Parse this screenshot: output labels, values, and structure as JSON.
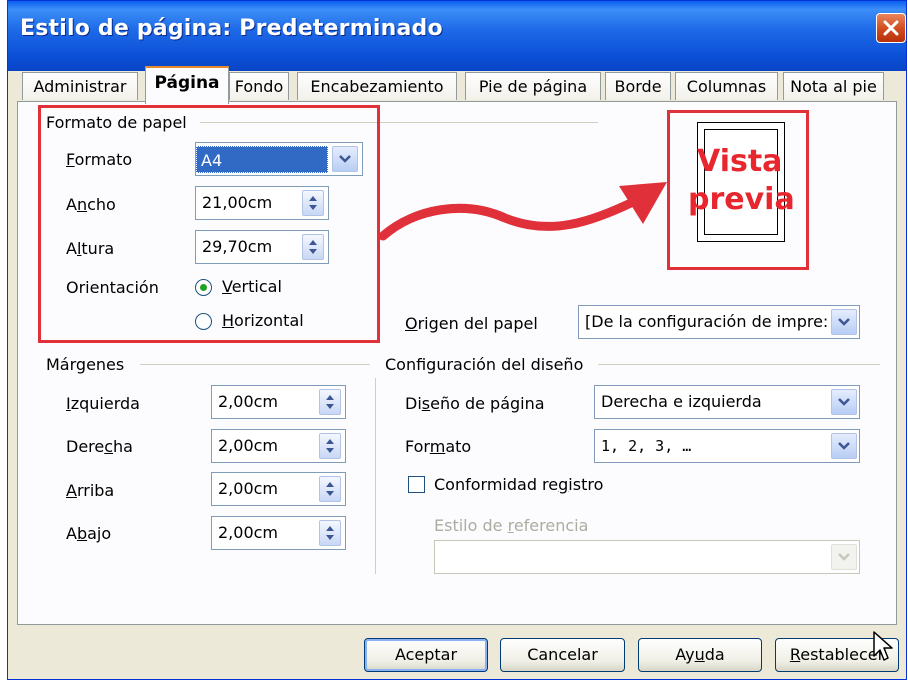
{
  "window": {
    "title": "Estilo de página: Predeterminado"
  },
  "tabs": [
    {
      "label": "Administrar"
    },
    {
      "label": "Página"
    },
    {
      "label": "Fondo"
    },
    {
      "label": "Encabezamiento"
    },
    {
      "label": "Pie de página"
    },
    {
      "label": "Borde"
    },
    {
      "label": "Columnas"
    },
    {
      "label": "Nota al pie"
    }
  ],
  "active_tab": "Página",
  "paper_format": {
    "section_title": "Formato de papel",
    "format_label": "Formato",
    "format_value": "A4",
    "width_label": "Ancho",
    "width_value": "21,00cm",
    "height_label": "Altura",
    "height_value": "29,70cm",
    "orientation_label": "Orientación",
    "portrait_label": "Vertical",
    "landscape_label": "Horizontal",
    "selected_orientation": "Vertical"
  },
  "preview": {
    "annotation_line1": "Vista",
    "annotation_line2": "previa"
  },
  "paper_source": {
    "label": "Origen del papel",
    "value": "[De la configuración de impre:"
  },
  "margins": {
    "section_title": "Márgenes",
    "left_label": "Izquierda",
    "left_value": "2,00cm",
    "right_label": "Derecha",
    "right_value": "2,00cm",
    "top_label": "Arriba",
    "top_value": "2,00cm",
    "bottom_label": "Abajo",
    "bottom_value": "2,00cm"
  },
  "layout_settings": {
    "section_title": "Configuración del diseño",
    "page_layout_label": "Diseño de página",
    "page_layout_value": "Derecha e izquierda",
    "format_label": "Formato",
    "format_value": "1, 2, 3, …",
    "register_true_label": "Conformidad registro",
    "register_true_checked": false,
    "reference_style_label": "Estilo de referencia",
    "reference_style_value": ""
  },
  "buttons": {
    "ok": "Aceptar",
    "cancel": "Cancelar",
    "help": "Ayuda",
    "reset": "Restablecer"
  },
  "colors": {
    "title_bar": "#0a5ff0",
    "highlight_red": "#e0303a",
    "selection": "#316ac5",
    "dialog_face": "#ece9d8"
  },
  "icons": [
    "close-icon",
    "dropdown-arrow-icon",
    "spin-arrows-icon",
    "curved-arrow-icon",
    "mouse-cursor-icon"
  ]
}
